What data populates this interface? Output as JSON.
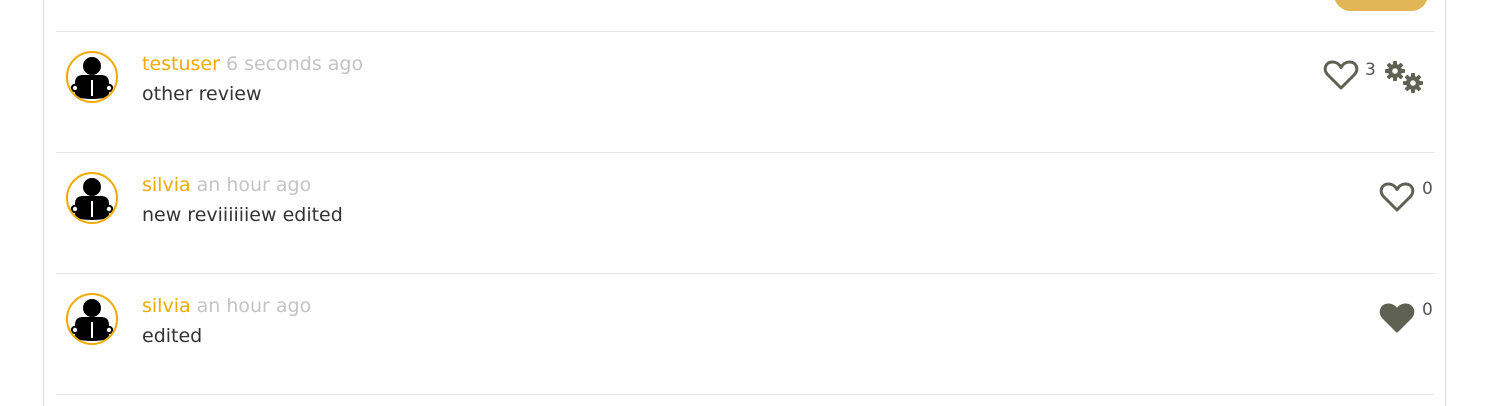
{
  "reviews": [
    {
      "username": "testuser",
      "time": "6 seconds ago",
      "text": "other review",
      "likes": "3",
      "liked": false,
      "has_settings": true
    },
    {
      "username": "silvia",
      "time": "an hour ago",
      "text": "new reviiiiiiew edited",
      "likes": "0",
      "liked": false,
      "has_settings": false
    },
    {
      "username": "silvia",
      "time": "an hour ago",
      "text": "edited",
      "likes": "0",
      "liked": true,
      "has_settings": false
    }
  ],
  "icons": {
    "avatar": "reader-avatar-icon",
    "like_empty": "heart-outline-icon",
    "like_filled": "heart-filled-icon",
    "settings": "gears-icon"
  },
  "colors": {
    "accent": "#f2a900",
    "button": "#e2b556",
    "icon": "#5f6152",
    "muted_text": "#c4c4c4",
    "body_text": "#333333"
  }
}
